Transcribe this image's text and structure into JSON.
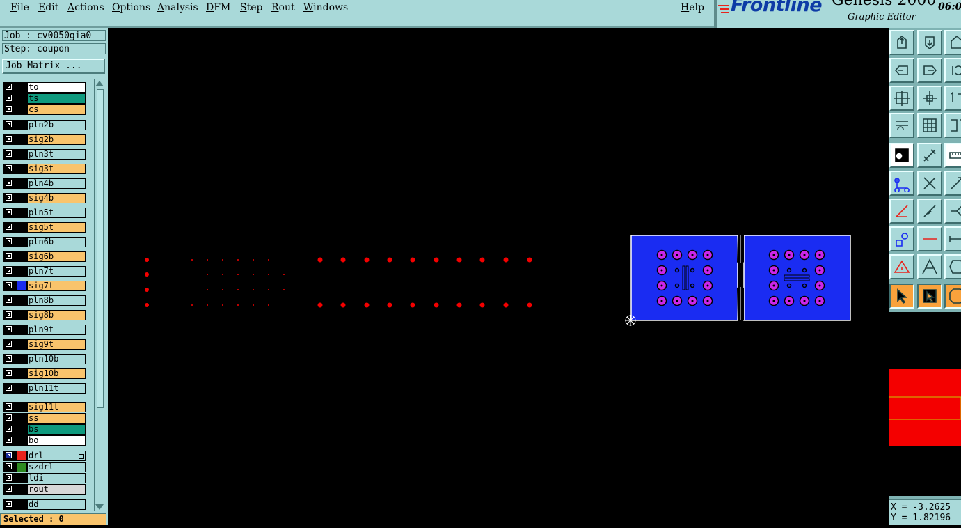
{
  "menubar": {
    "items": [
      "File",
      "Edit",
      "Actions",
      "Options",
      "Analysis",
      "DFM",
      "Step",
      "Rout",
      "Windows"
    ],
    "help": "Help"
  },
  "branding": {
    "logo": "Frontline",
    "product": "Genesis 2000",
    "subtitle": "Graphic Editor",
    "clock": "06:0"
  },
  "job": {
    "job_label": "Job : cv0050gia0",
    "step_label": "Step: coupon",
    "matrix_button": "Job Matrix ..."
  },
  "layers": [
    {
      "name": "to",
      "bg": "#ffffff",
      "group": 0
    },
    {
      "name": "ts",
      "bg": "#0f9a7e",
      "group": 0
    },
    {
      "name": "cs",
      "bg": "#f9c46c",
      "group": 0
    },
    {
      "name": "pln2b",
      "bg": "#a9d9d9",
      "group": 1
    },
    {
      "name": "sig2b",
      "bg": "#f9c46c",
      "group": 1
    },
    {
      "name": "pln3t",
      "bg": "#a9d9d9",
      "group": 1
    },
    {
      "name": "sig3t",
      "bg": "#f9c46c",
      "group": 1
    },
    {
      "name": "pln4b",
      "bg": "#a9d9d9",
      "group": 1
    },
    {
      "name": "sig4b",
      "bg": "#f9c46c",
      "group": 1
    },
    {
      "name": "pln5t",
      "bg": "#a9d9d9",
      "group": 1
    },
    {
      "name": "sig5t",
      "bg": "#f9c46c",
      "group": 1
    },
    {
      "name": "pln6b",
      "bg": "#a9d9d9",
      "group": 1
    },
    {
      "name": "sig6b",
      "bg": "#f9c46c",
      "group": 1
    },
    {
      "name": "pln7t",
      "bg": "#a9d9d9",
      "group": 1
    },
    {
      "name": "sig7t",
      "bg": "#f9c46c",
      "group": 1,
      "color": "#1a2cf2"
    },
    {
      "name": "pln8b",
      "bg": "#a9d9d9",
      "group": 1
    },
    {
      "name": "sig8b",
      "bg": "#f9c46c",
      "group": 1
    },
    {
      "name": "pln9t",
      "bg": "#a9d9d9",
      "group": 1
    },
    {
      "name": "sig9t",
      "bg": "#f9c46c",
      "group": 1
    },
    {
      "name": "pln10b",
      "bg": "#a9d9d9",
      "group": 1
    },
    {
      "name": "sig10b",
      "bg": "#f9c46c",
      "group": 1
    },
    {
      "name": "pln11t",
      "bg": "#a9d9d9",
      "group": 1
    },
    {
      "name": "sig11t",
      "bg": "#f9c46c",
      "group": 2
    },
    {
      "name": "ss",
      "bg": "#f9c46c",
      "group": 2
    },
    {
      "name": "bs",
      "bg": "#0f9a7e",
      "group": 2
    },
    {
      "name": "bo",
      "bg": "#ffffff",
      "group": 2
    },
    {
      "name": "drl",
      "bg": "#a9d9d9",
      "group": 3,
      "color": "#e8231c",
      "checked": true,
      "flag": true
    },
    {
      "name": "szdrl",
      "bg": "#a9d9d9",
      "group": 3,
      "color": "#2e8b22"
    },
    {
      "name": "ldi",
      "bg": "#a9d9d9",
      "group": 3
    },
    {
      "name": "rout",
      "bg": "#d8d8d8",
      "group": 3
    },
    {
      "name": "dd",
      "bg": "#a9d9d9",
      "group": 4
    }
  ],
  "status": {
    "selected": "Selected : 0"
  },
  "coords": {
    "x": "X = -3.2625",
    "y": "Y = 1.82196"
  },
  "tools": [
    "move-up-icon",
    "move-down-icon",
    "home-icon",
    "move-left-icon",
    "move-right-icon",
    "rotate-icon",
    "zoom-fit-icon",
    "zoom-pan-icon",
    "scale-1to1-icon",
    "settings-icon",
    "grid-icon",
    "snap-icon",
    "display-icon",
    "edit-shape-icon",
    "ruler-icon",
    "net-icon",
    "cross-icon",
    "arrow-icon",
    "angle-icon",
    "slope-icon",
    "bend-icon",
    "feature-icon",
    "line-icon",
    "measure-icon",
    "triangle-icon",
    "peak-icon",
    "polygon-icon",
    "pointer-icon",
    "select-pointer-icon",
    "stop-icon"
  ],
  "colors": {
    "panel": "#a9d9d9",
    "feature_red": "#f40000",
    "copper_blue": "#1a2cf2",
    "pad_magenta": "#cc26ea"
  }
}
